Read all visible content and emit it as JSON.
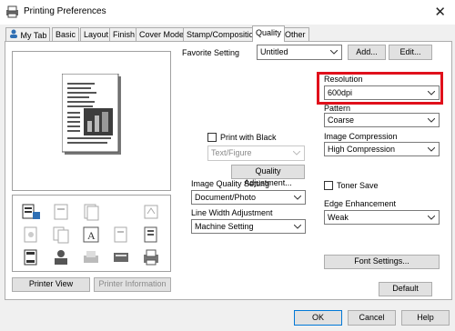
{
  "window": {
    "title": "Printing Preferences",
    "close_glyph": "✕"
  },
  "tabs": [
    {
      "label": "My Tab"
    },
    {
      "label": "Basic"
    },
    {
      "label": "Layout"
    },
    {
      "label": "Finish"
    },
    {
      "label": "Cover Mode"
    },
    {
      "label": "Stamp/Composition"
    },
    {
      "label": "Quality",
      "active": true
    },
    {
      "label": "Other"
    }
  ],
  "favorite": {
    "label": "Favorite Setting",
    "value": "Untitled",
    "add_label": "Add...",
    "edit_label": "Edit..."
  },
  "preview": {
    "printer_view_label": "Printer View",
    "printer_info_label": "Printer Information"
  },
  "print_with_black": {
    "label": "Print with Black",
    "checked": false,
    "text_figure_value": "Text/Figure"
  },
  "quality_adjustment_label": "Quality Adjustment...",
  "image_quality": {
    "label": "Image Quality Setting",
    "value": "Document/Photo"
  },
  "line_width": {
    "label": "Line Width Adjustment",
    "value": "Machine Setting"
  },
  "resolution": {
    "label": "Resolution",
    "value": "600dpi"
  },
  "pattern": {
    "label": "Pattern",
    "value": "Coarse"
  },
  "image_compression": {
    "label": "Image Compression",
    "value": "High Compression"
  },
  "toner_save": {
    "label": "Toner Save",
    "checked": false
  },
  "edge_enhancement": {
    "label": "Edge Enhancement",
    "value": "Weak"
  },
  "font_settings_label": "Font Settings...",
  "default_label": "Default",
  "footer": {
    "ok": "OK",
    "cancel": "Cancel",
    "help": "Help"
  },
  "colors": {
    "highlight": "#e0101b",
    "tab_border": "#adadad",
    "button_face": "#e1e1e1"
  }
}
